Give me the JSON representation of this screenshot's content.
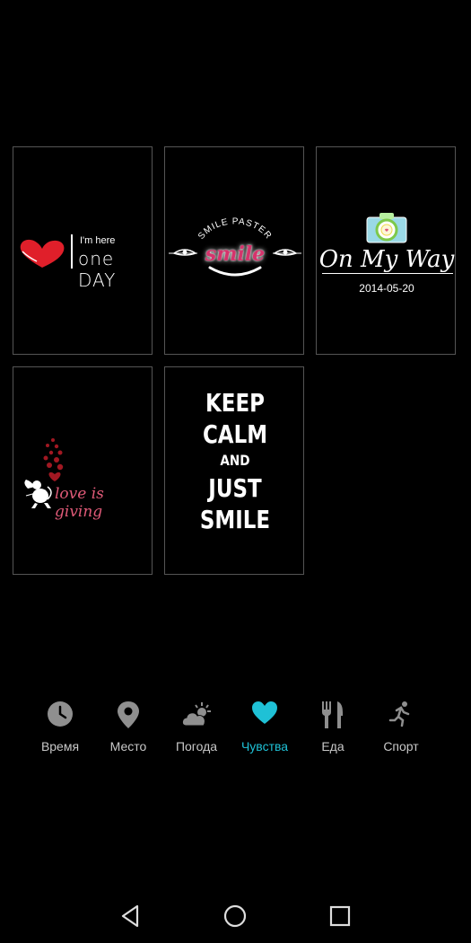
{
  "stickers": [
    {
      "name": "one-day",
      "small": "I'm here",
      "big": "one DAY"
    },
    {
      "name": "smile",
      "arc": "SMILE PASTER",
      "word": "smile"
    },
    {
      "name": "on-my-way",
      "text": "On My Way",
      "date": "2014-05-20"
    },
    {
      "name": "love-is-giving",
      "text": "love is giving"
    },
    {
      "name": "keep-calm",
      "lines": [
        "KEEP",
        "CALM",
        "AND",
        "JUST",
        "SMILE"
      ]
    }
  ],
  "categories": [
    {
      "label": "Время",
      "icon": "clock-icon"
    },
    {
      "label": "Место",
      "icon": "location-pin-icon"
    },
    {
      "label": "Погода",
      "icon": "weather-cloud-sun-icon"
    },
    {
      "label": "Чувства",
      "icon": "heart-icon"
    },
    {
      "label": "Еда",
      "icon": "fork-knife-icon"
    },
    {
      "label": "Спорт",
      "icon": "running-person-icon"
    }
  ],
  "active_category": "Чувства",
  "colors": {
    "accent": "#1fc1d6",
    "inactive": "#8f8f8f",
    "heart_red": "#e01f2a",
    "smile_pink": "#d6336c"
  },
  "nav": {
    "back": "back-triangle-icon",
    "home": "home-circle-icon",
    "recents": "recents-square-icon"
  }
}
